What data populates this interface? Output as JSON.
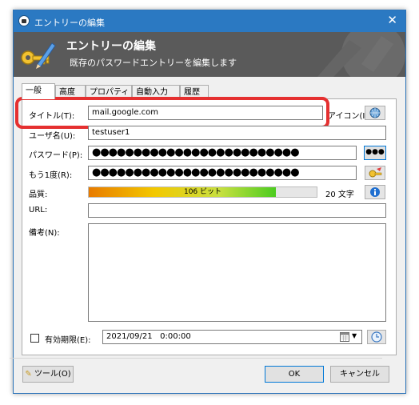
{
  "window": {
    "title": "エントリーの編集",
    "close_glyph": "✕"
  },
  "banner": {
    "title": "エントリーの編集",
    "subtitle": "既存のパスワードエントリーを編集します"
  },
  "tabs": [
    {
      "label": "一般",
      "active": true
    },
    {
      "label": "高度"
    },
    {
      "label": "プロパティ"
    },
    {
      "label": "自動入力"
    },
    {
      "label": "履歴"
    }
  ],
  "fields": {
    "title_label": "タイトル(T):",
    "title_value": "mail.google.com",
    "icon_label": "アイコン(I):",
    "username_label": "ユーザ名(U):",
    "username_value": "testuser1",
    "password_label": "パスワード(P):",
    "password_value": "●●●●●●●●●●●●●●●●●●●●●●●●●",
    "repeat_label": "もう1度(R):",
    "repeat_value": "●●●●●●●●●●●●●●●●●●●●●●●●●",
    "quality_label": "品質:",
    "quality_text": "106 ビット",
    "quality_fraction": 0.82,
    "char_count": "20 文字",
    "url_label": "URL:",
    "url_value": "",
    "notes_label": "備考(N):",
    "notes_value": "",
    "expiry_label": "有効期限(E):",
    "expiry_value": "2021/09/21   0:00:00",
    "expiry_checked": false
  },
  "buttons": {
    "show_password": "●●●",
    "tools": "ツール(O)",
    "ok": "OK",
    "cancel": "キャンセル"
  },
  "colors": {
    "titlebar": "#2b79c2",
    "banner": "#5a5a5a",
    "highlight": "#e53030"
  }
}
